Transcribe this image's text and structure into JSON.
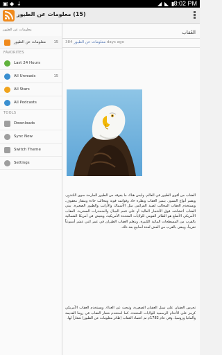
{
  "status_bar": {
    "time": "8:02 PM",
    "icons": [
      "image-icon",
      "shield-icon",
      "download-icon",
      "wifi-icon",
      "signal-icon",
      "battery-icon"
    ]
  },
  "action_bar": {
    "title": "(15) معلومات عن الطيور",
    "app_icon": "rss-icon",
    "menu_icon": "overflow-menu-icon"
  },
  "sidebar": {
    "subscription_label": "معلومات عن الطيور",
    "feed": {
      "label": "معلومات عن الطيور",
      "count": "15"
    },
    "favorites_header": "FAVORITES",
    "favorites": [
      {
        "label": "Last 24 Hours",
        "count": "",
        "icon": "clock-icon",
        "color": "#61b33d"
      },
      {
        "label": "All Unreads",
        "count": "15",
        "icon": "unread-icon",
        "color": "#3a8fd0"
      },
      {
        "label": "All Stars",
        "count": "",
        "icon": "star-icon",
        "color": "#f0a31c"
      },
      {
        "label": "All Podcasts",
        "count": "",
        "icon": "podcast-icon",
        "color": "#3a8fd0"
      }
    ],
    "tools_header": "TOOLS",
    "tools": [
      {
        "label": "Downloads",
        "icon": "download-icon"
      },
      {
        "label": "Sync Now",
        "icon": "sync-icon"
      },
      {
        "label": "Switch Theme",
        "icon": "theme-icon"
      },
      {
        "label": "Settings",
        "icon": "settings-icon"
      }
    ]
  },
  "article": {
    "title": "العُقاب",
    "age": "384 days ago",
    "feed_name": "معلومات عن الطيور",
    "image": "bald-eagle-photo",
    "paragraph1": "العقاب من أقوى الطيور في العالم، وليس هناك ما يفوقه من الطيور الجارحة سوى الكندور، ويضم أنواع النسور. يتميز العقاب ونظره حاد وقوائمه قوية ومخالب حادة ومنقار معقوف، ويستخدم العقاب المخالب لصيد الفرائس مثل الأسماك والأرانب والطيور الصغيرة. يبني العقاب أعشاشه فوق الأشجار العالية أو على قمم الجبال والمنحدرات الصخرية. العقاب الأمريكي الأصلع هو الطائر القومي للولايات المتحدة الأمريكية، ويعيش في أمريكا الشمالية بالقرب من المسطحات المائية الكبيرة. ويتعلم العقاب الطيران في عمر اثني عشر أسبوعاً تقريباً، ويبقى بالقرب من العش لعدة أسابيع بعد ذلك.",
    "paragraph2": "تحرس العقبان على نسل العقبان الصغيرة، وتبحث عن الغذاء. ويستخدم العقاب الأمريكي كرمز على الأختام الرسمية للولايات المتحدة. كما استخدم شعار العقاب في روما القديمة وألمانيا وروسيا. وفي عام 1782م تم اعتماد العقاب (طائر معلومات عن الطيور) شعاراً لها."
  }
}
